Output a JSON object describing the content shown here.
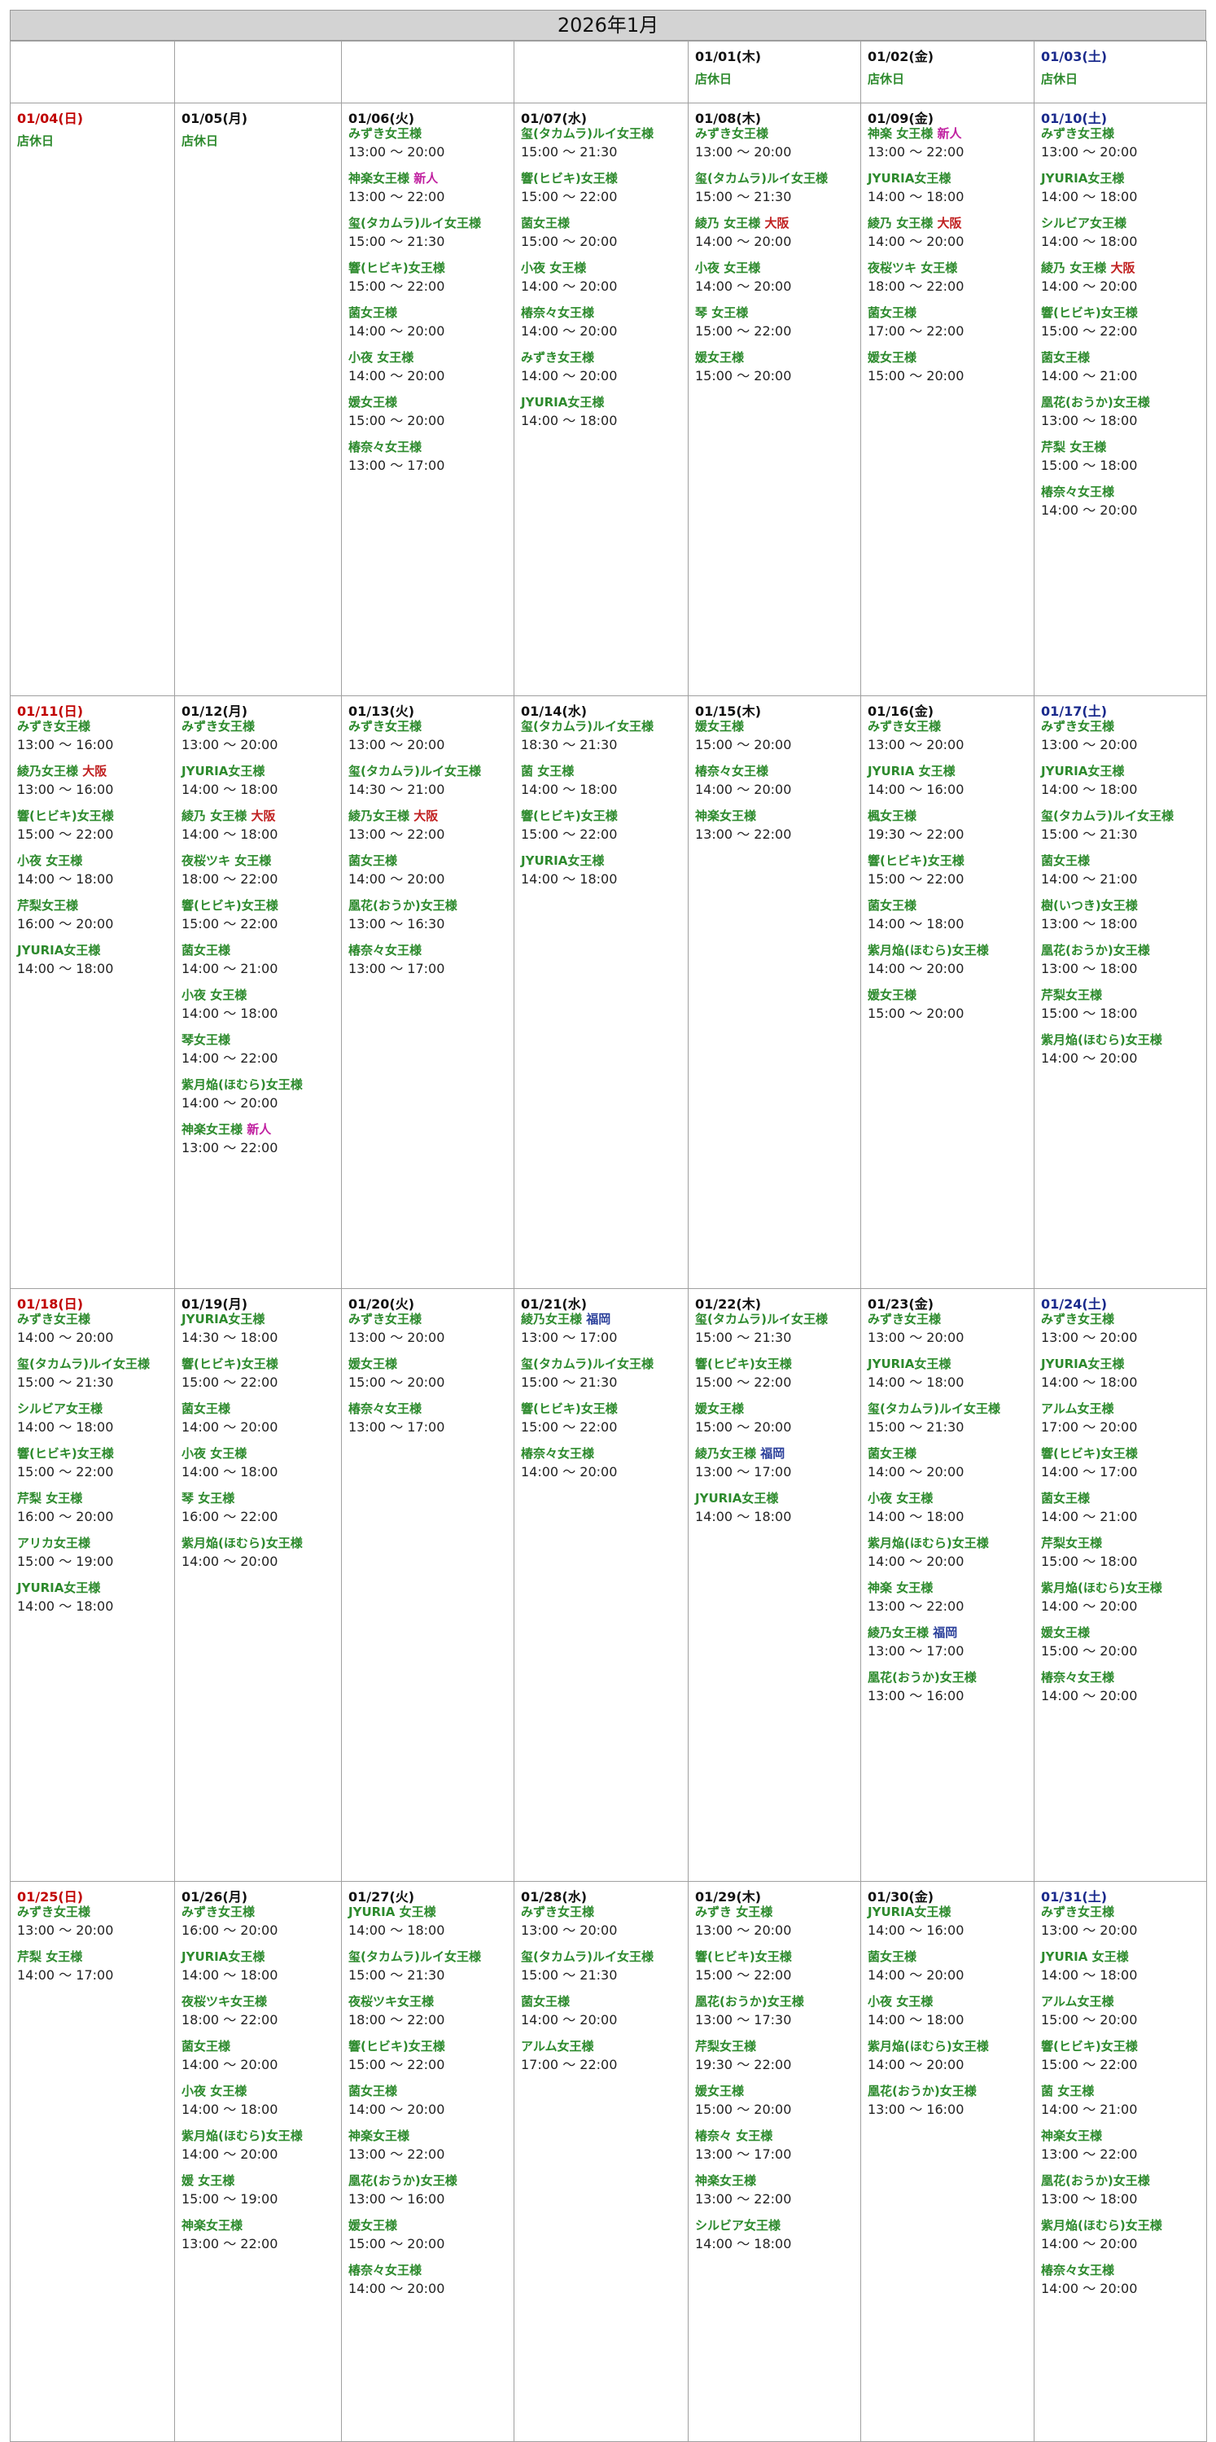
{
  "title": "2026年1月",
  "colors": {
    "name": "#2d8a2d",
    "sunday": "#c00000",
    "saturday": "#1a2a8c",
    "new": "#c020a0",
    "osaka": "#c02020",
    "fukuoka": "#2a3f9a"
  },
  "weeks": [
    [
      null,
      null,
      null,
      null,
      {
        "date": "01/01(木)",
        "closed": "店休日"
      },
      {
        "date": "01/02(金)",
        "closed": "店休日"
      },
      {
        "date": "01/03(土)",
        "type": "sat",
        "closed": "店休日"
      }
    ],
    [
      {
        "date": "01/04(日)",
        "type": "sun",
        "closed": "店休日"
      },
      {
        "date": "01/05(月)",
        "closed": "店休日"
      },
      {
        "date": "01/06(火)",
        "entries": [
          {
            "name": "みずき女王様",
            "time": "13:00 ～ 20:00"
          },
          {
            "name": "神楽女王様",
            "tag": "新人",
            "tagType": "new",
            "time": "13:00 ～ 22:00"
          },
          {
            "name": "玺(タカムラ)ルイ女王様",
            "time": "15:00 ～ 21:30"
          },
          {
            "name": "響(ヒビキ)女王様",
            "time": "15:00 ～ 22:00"
          },
          {
            "name": "菌女王様",
            "time": "14:00 ～ 20:00"
          },
          {
            "name": "小夜 女王様",
            "time": "14:00 ～ 20:00"
          },
          {
            "name": "媛女王様",
            "time": "15:00 ～ 20:00"
          },
          {
            "name": "椿奈々女王様",
            "time": "13:00 ～ 17:00"
          }
        ]
      },
      {
        "date": "01/07(水)",
        "entries": [
          {
            "name": "玺(タカムラ)ルイ女王様",
            "time": "15:00 ～ 21:30"
          },
          {
            "name": "響(ヒビキ)女王様",
            "time": "15:00 ～ 22:00"
          },
          {
            "name": "菌女王様",
            "time": "15:00 ～ 20:00"
          },
          {
            "name": "小夜 女王様",
            "time": "14:00 ～ 20:00"
          },
          {
            "name": "椿奈々女王様",
            "time": "14:00 ～ 20:00"
          },
          {
            "name": "みずき女王様",
            "time": "14:00 ～ 20:00"
          },
          {
            "name": "JYURIA女王様",
            "time": "14:00 ～ 18:00"
          }
        ]
      },
      {
        "date": "01/08(木)",
        "entries": [
          {
            "name": "みずき女王様",
            "time": "13:00 ～ 20:00"
          },
          {
            "name": "玺(タカムラ)ルイ女王様",
            "time": "15:00 ～ 21:30"
          },
          {
            "name": "綾乃 女王様",
            "tag": "大阪",
            "tagType": "osaka",
            "time": "14:00 ～ 20:00"
          },
          {
            "name": "小夜 女王様",
            "time": "14:00 ～ 20:00"
          },
          {
            "name": "琴 女王様",
            "time": "15:00 ～ 22:00"
          },
          {
            "name": "媛女王様",
            "time": "15:00 ～ 20:00"
          }
        ]
      },
      {
        "date": "01/09(金)",
        "entries": [
          {
            "name": "神楽 女王様",
            "tag": "新人",
            "tagType": "new",
            "time": "13:00 ～ 22:00"
          },
          {
            "name": "JYURIA女王様",
            "time": "14:00 ～ 18:00"
          },
          {
            "name": "綾乃 女王様",
            "tag": "大阪",
            "tagType": "osaka",
            "time": "14:00 ～ 20:00"
          },
          {
            "name": "夜桜ツキ 女王様",
            "time": "18:00 ～ 22:00"
          },
          {
            "name": "菌女王様",
            "time": "17:00 ～ 22:00"
          },
          {
            "name": "媛女王様",
            "time": "15:00 ～ 20:00"
          }
        ]
      },
      {
        "date": "01/10(土)",
        "type": "sat",
        "entries": [
          {
            "name": "みずき女王様",
            "time": "13:00 ～ 20:00"
          },
          {
            "name": "JYURIA女王様",
            "time": "14:00 ～ 18:00"
          },
          {
            "name": "シルビア女王様",
            "time": "14:00 ～ 18:00"
          },
          {
            "name": "綾乃 女王様",
            "tag": "大阪",
            "tagType": "osaka",
            "time": "14:00 ～ 20:00"
          },
          {
            "name": "響(ヒビキ)女王様",
            "time": "15:00 ～ 22:00"
          },
          {
            "name": "菌女王様",
            "time": "14:00 ～ 21:00"
          },
          {
            "name": "凰花(おうか)女王様",
            "time": "13:00 ～ 18:00"
          },
          {
            "name": "芹梨 女王様",
            "time": "15:00 ～ 18:00"
          },
          {
            "name": "椿奈々女王様",
            "time": "14:00 ～ 20:00"
          }
        ]
      }
    ],
    [
      {
        "date": "01/11(日)",
        "type": "sun",
        "entries": [
          {
            "name": "みずき女王様",
            "time": "13:00 ～ 16:00"
          },
          {
            "name": "綾乃女王様",
            "tag": "大阪",
            "tagType": "osaka",
            "time": "13:00 ～ 16:00"
          },
          {
            "name": "響(ヒビキ)女王様",
            "time": "15:00 ～ 22:00"
          },
          {
            "name": "小夜 女王様",
            "time": "14:00 ～ 18:00"
          },
          {
            "name": "芹梨女王様",
            "time": "16:00 ～ 20:00"
          },
          {
            "name": "JYURIA女王様",
            "time": "14:00 ～ 18:00"
          }
        ]
      },
      {
        "date": "01/12(月)",
        "entries": [
          {
            "name": "みずき女王様",
            "time": "13:00 ～ 20:00"
          },
          {
            "name": "JYURIA女王様",
            "time": "14:00 ～ 18:00"
          },
          {
            "name": "綾乃 女王様",
            "tag": "大阪",
            "tagType": "osaka",
            "time": "14:00 ～ 18:00"
          },
          {
            "name": "夜桜ツキ 女王様",
            "time": "18:00 ～ 22:00"
          },
          {
            "name": "響(ヒビキ)女王様",
            "time": "15:00 ～ 22:00"
          },
          {
            "name": "菌女王様",
            "time": "14:00 ～ 21:00"
          },
          {
            "name": "小夜 女王様",
            "time": "14:00 ～ 18:00"
          },
          {
            "name": "琴女王様",
            "time": "14:00 ～ 22:00"
          },
          {
            "name": "紫月焔(ほむら)女王様",
            "time": "14:00 ～ 20:00"
          },
          {
            "name": "神楽女王様",
            "tag": "新人",
            "tagType": "new",
            "time": "13:00 ～ 22:00"
          }
        ]
      },
      {
        "date": "01/13(火)",
        "entries": [
          {
            "name": "みずき女王様",
            "time": "13:00 ～ 20:00"
          },
          {
            "name": "玺(タカムラ)ルイ女王様",
            "time": "14:30 ～ 21:00"
          },
          {
            "name": "綾乃女王様",
            "tag": "大阪",
            "tagType": "osaka",
            "time": "13:00 ～ 22:00"
          },
          {
            "name": "菌女王様",
            "time": "14:00 ～ 20:00"
          },
          {
            "name": "凰花(おうか)女王様",
            "time": "13:00 ～ 16:30"
          },
          {
            "name": "椿奈々女王様",
            "time": "13:00 ～ 17:00"
          }
        ]
      },
      {
        "date": "01/14(水)",
        "entries": [
          {
            "name": "玺(タカムラ)ルイ女王様",
            "time": "18:30 ～ 21:30"
          },
          {
            "name": "菌 女王様",
            "time": "14:00 ～ 18:00"
          },
          {
            "name": "響(ヒビキ)女王様",
            "time": "15:00 ～ 22:00"
          },
          {
            "name": "JYURIA女王様",
            "time": "14:00 ～ 18:00"
          }
        ]
      },
      {
        "date": "01/15(木)",
        "entries": [
          {
            "name": "媛女王様",
            "time": "15:00 ～ 20:00"
          },
          {
            "name": "椿奈々女王様",
            "time": "14:00 ～ 20:00"
          },
          {
            "name": "神楽女王様",
            "time": "13:00 ～ 22:00"
          }
        ]
      },
      {
        "date": "01/16(金)",
        "entries": [
          {
            "name": "みずき女王様",
            "time": "13:00 ～ 20:00"
          },
          {
            "name": "JYURIA 女王様",
            "time": "14:00 ～ 16:00"
          },
          {
            "name": "楓女王様",
            "time": "19:30 ～ 22:00"
          },
          {
            "name": "響(ヒビキ)女王様",
            "time": "15:00 ～ 22:00"
          },
          {
            "name": "菌女王様",
            "time": "14:00 ～ 18:00"
          },
          {
            "name": "紫月焔(ほむら)女王様",
            "time": "14:00 ～ 20:00"
          },
          {
            "name": "媛女王様",
            "time": "15:00 ～ 20:00"
          }
        ]
      },
      {
        "date": "01/17(土)",
        "type": "sat",
        "entries": [
          {
            "name": "みずき女王様",
            "time": "13:00 ～ 20:00"
          },
          {
            "name": "JYURIA女王様",
            "time": "14:00 ～ 18:00"
          },
          {
            "name": "玺(タカムラ)ルイ女王様",
            "time": "15:00 ～ 21:30"
          },
          {
            "name": "菌女王様",
            "time": "14:00 ～ 21:00"
          },
          {
            "name": "樹(いつき)女王様",
            "time": "13:00 ～ 18:00"
          },
          {
            "name": "凰花(おうか)女王様",
            "time": "13:00 ～ 18:00"
          },
          {
            "name": "芹梨女王様",
            "time": "15:00 ～ 18:00"
          },
          {
            "name": "紫月焔(ほむら)女王様",
            "time": "14:00 ～ 20:00"
          }
        ]
      }
    ],
    [
      {
        "date": "01/18(日)",
        "type": "sun",
        "entries": [
          {
            "name": "みずき女王様",
            "time": "14:00 ～ 20:00"
          },
          {
            "name": "玺(タカムラ)ルイ女王様",
            "time": "15:00 ～ 21:30"
          },
          {
            "name": "シルビア女王様",
            "time": "14:00 ～ 18:00"
          },
          {
            "name": "響(ヒビキ)女王様",
            "time": "15:00 ～ 22:00"
          },
          {
            "name": "芹梨 女王様",
            "time": "16:00 ～ 20:00"
          },
          {
            "name": "アリカ女王様",
            "time": "15:00 ～ 19:00"
          },
          {
            "name": "JYURIA女王様",
            "time": "14:00 ～ 18:00"
          }
        ]
      },
      {
        "date": "01/19(月)",
        "entries": [
          {
            "name": "JYURIA女王様",
            "time": "14:30 ～ 18:00"
          },
          {
            "name": "響(ヒビキ)女王様",
            "time": "15:00 ～ 22:00"
          },
          {
            "name": "菌女王様",
            "time": "14:00 ～ 20:00"
          },
          {
            "name": "小夜 女王様",
            "time": "14:00 ～ 18:00"
          },
          {
            "name": "琴 女王様",
            "time": "16:00 ～ 22:00"
          },
          {
            "name": "紫月焔(ほむら)女王様",
            "time": "14:00 ～ 20:00"
          }
        ]
      },
      {
        "date": "01/20(火)",
        "entries": [
          {
            "name": "みずき女王様",
            "time": "13:00 ～ 20:00"
          },
          {
            "name": "媛女王様",
            "time": "15:00 ～ 20:00"
          },
          {
            "name": "椿奈々女王様",
            "time": "13:00 ～ 17:00"
          }
        ]
      },
      {
        "date": "01/21(水)",
        "entries": [
          {
            "name": "綾乃女王様",
            "tag": "福岡",
            "tagType": "fukuoka",
            "time": "13:00 ～ 17:00"
          },
          {
            "name": "玺(タカムラ)ルイ女王様",
            "time": "15:00 ～ 21:30"
          },
          {
            "name": "響(ヒビキ)女王様",
            "time": "15:00 ～ 22:00"
          },
          {
            "name": "椿奈々女王様",
            "time": "14:00 ～ 20:00"
          }
        ]
      },
      {
        "date": "01/22(木)",
        "entries": [
          {
            "name": "玺(タカムラ)ルイ女王様",
            "time": "15:00 ～ 21:30"
          },
          {
            "name": "響(ヒビキ)女王様",
            "time": "15:00 ～ 22:00"
          },
          {
            "name": "媛女王様",
            "time": "15:00 ～ 20:00"
          },
          {
            "name": "綾乃女王様",
            "tag": "福岡",
            "tagType": "fukuoka",
            "time": "13:00 ～ 17:00"
          },
          {
            "name": "JYURIA女王様",
            "time": "14:00 ～ 18:00"
          }
        ]
      },
      {
        "date": "01/23(金)",
        "entries": [
          {
            "name": "みずき女王様",
            "time": "13:00 ～ 20:00"
          },
          {
            "name": "JYURIA女王様",
            "time": "14:00 ～ 18:00"
          },
          {
            "name": "玺(タカムラ)ルイ女王様",
            "time": "15:00 ～ 21:30"
          },
          {
            "name": "菌女王様",
            "time": "14:00 ～ 20:00"
          },
          {
            "name": "小夜 女王様",
            "time": "14:00 ～ 18:00"
          },
          {
            "name": "紫月焔(ほむら)女王様",
            "time": "14:00 ～ 20:00"
          },
          {
            "name": "神楽 女王様",
            "time": "13:00 ～ 22:00"
          },
          {
            "name": "綾乃女王様",
            "tag": "福岡",
            "tagType": "fukuoka",
            "time": "13:00 ～ 17:00"
          },
          {
            "name": "凰花(おうか)女王様",
            "time": "13:00 ～ 16:00"
          }
        ]
      },
      {
        "date": "01/24(土)",
        "type": "sat",
        "entries": [
          {
            "name": "みずき女王様",
            "time": "13:00 ～ 20:00"
          },
          {
            "name": "JYURIA女王様",
            "time": "14:00 ～ 18:00"
          },
          {
            "name": "アルム女王様",
            "time": "17:00 ～ 20:00"
          },
          {
            "name": "響(ヒビキ)女王様",
            "time": "14:00 ～ 17:00"
          },
          {
            "name": "菌女王様",
            "time": "14:00 ～ 21:00"
          },
          {
            "name": "芹梨女王様",
            "time": "15:00 ～ 18:00"
          },
          {
            "name": "紫月焔(ほむら)女王様",
            "time": "14:00 ～ 20:00"
          },
          {
            "name": "媛女王様",
            "time": "15:00 ～ 20:00"
          },
          {
            "name": "椿奈々女王様",
            "time": "14:00 ～ 20:00"
          }
        ]
      }
    ],
    [
      {
        "date": "01/25(日)",
        "type": "sun",
        "entries": [
          {
            "name": "みずき女王様",
            "time": "13:00 ～ 20:00"
          },
          {
            "name": "芹梨 女王様",
            "time": "14:00 ～ 17:00"
          }
        ]
      },
      {
        "date": "01/26(月)",
        "entries": [
          {
            "name": "みずき女王様",
            "time": "16:00 ～ 20:00"
          },
          {
            "name": "JYURIA女王様",
            "time": "14:00 ～ 18:00"
          },
          {
            "name": "夜桜ツキ女王様",
            "time": "18:00 ～ 22:00"
          },
          {
            "name": "菌女王様",
            "time": "14:00 ～ 20:00"
          },
          {
            "name": "小夜 女王様",
            "time": "14:00 ～ 18:00"
          },
          {
            "name": "紫月焔(ほむら)女王様",
            "time": "14:00 ～ 20:00"
          },
          {
            "name": "媛 女王様",
            "time": "15:00 ～ 19:00"
          },
          {
            "name": "神楽女王様",
            "time": "13:00 ～ 22:00"
          }
        ]
      },
      {
        "date": "01/27(火)",
        "entries": [
          {
            "name": "JYURIA 女王様",
            "time": "14:00 ～ 18:00"
          },
          {
            "name": "玺(タカムラ)ルイ女王様",
            "time": "15:00 ～ 21:30"
          },
          {
            "name": "夜桜ツキ女王様",
            "time": "18:00 ～ 22:00"
          },
          {
            "name": "響(ヒビキ)女王様",
            "time": "15:00 ～ 22:00"
          },
          {
            "name": "菌女王様",
            "time": "14:00 ～ 20:00"
          },
          {
            "name": "神楽女王様",
            "time": "13:00 ～ 22:00"
          },
          {
            "name": "凰花(おうか)女王様",
            "time": "13:00 ～ 16:00"
          },
          {
            "name": "媛女王様",
            "time": "15:00 ～ 20:00"
          },
          {
            "name": "椿奈々女王様",
            "time": "14:00 ～ 20:00"
          }
        ]
      },
      {
        "date": "01/28(水)",
        "entries": [
          {
            "name": "みずき女王様",
            "time": "13:00 ～ 20:00"
          },
          {
            "name": "玺(タカムラ)ルイ女王様",
            "time": "15:00 ～ 21:30"
          },
          {
            "name": "菌女王様",
            "time": "14:00 ～ 20:00"
          },
          {
            "name": "アルム女王様",
            "time": "17:00 ～ 22:00"
          }
        ]
      },
      {
        "date": "01/29(木)",
        "entries": [
          {
            "name": "みずき 女王様",
            "time": "13:00 ～ 20:00"
          },
          {
            "name": "響(ヒビキ)女王様",
            "time": "15:00 ～ 22:00"
          },
          {
            "name": "凰花(おうか)女王様",
            "time": "13:00 ～ 17:30"
          },
          {
            "name": "芹梨女王様",
            "time": "19:30 ～ 22:00"
          },
          {
            "name": "媛女王様",
            "time": "15:00 ～ 20:00"
          },
          {
            "name": "椿奈々 女王様",
            "time": "13:00 ～ 17:00"
          },
          {
            "name": "神楽女王様",
            "time": "13:00 ～ 22:00"
          },
          {
            "name": "シルビア女王様",
            "time": "14:00 ～ 18:00"
          }
        ]
      },
      {
        "date": "01/30(金)",
        "entries": [
          {
            "name": "JYURIA女王様",
            "time": "14:00 ～ 16:00"
          },
          {
            "name": "菌女王様",
            "time": "14:00 ～ 20:00"
          },
          {
            "name": "小夜 女王様",
            "time": "14:00 ～ 18:00"
          },
          {
            "name": "紫月焔(ほむら)女王様",
            "time": "14:00 ～ 20:00"
          },
          {
            "name": "凰花(おうか)女王様",
            "time": "13:00 ～ 16:00"
          }
        ]
      },
      {
        "date": "01/31(土)",
        "type": "sat",
        "entries": [
          {
            "name": "みずき女王様",
            "time": "13:00 ～ 20:00"
          },
          {
            "name": "JYURIA 女王様",
            "time": "14:00 ～ 18:00"
          },
          {
            "name": "アルム女王様",
            "time": "15:00 ～ 20:00"
          },
          {
            "name": "響(ヒビキ)女王様",
            "time": "15:00 ～ 22:00"
          },
          {
            "name": "菌 女王様",
            "time": "14:00 ～ 21:00"
          },
          {
            "name": "神楽女王様",
            "time": "13:00 ～ 22:00"
          },
          {
            "name": "凰花(おうか)女王様",
            "time": "13:00 ～ 18:00"
          },
          {
            "name": "紫月焔(ほむら)女王様",
            "time": "14:00 ～ 20:00"
          },
          {
            "name": "椿奈々女王様",
            "time": "14:00 ～ 20:00"
          }
        ]
      }
    ]
  ]
}
